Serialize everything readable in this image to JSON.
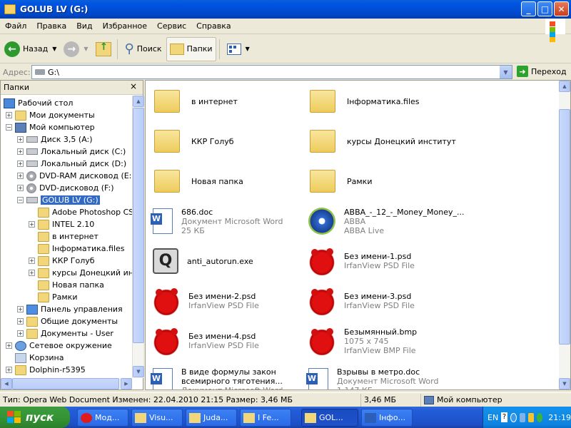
{
  "window": {
    "title": "GOLUB LV (G:)",
    "min": "_",
    "max": "□",
    "close": "✕"
  },
  "menu": [
    "Файл",
    "Правка",
    "Вид",
    "Избранное",
    "Сервис",
    "Справка"
  ],
  "toolbar": {
    "back": "Назад",
    "search": "Поиск",
    "folders": "Папки"
  },
  "address": {
    "label": "Адрес:",
    "value": "G:\\",
    "go": "Переход"
  },
  "folders_pane": {
    "title": "Папки",
    "close": "×",
    "items": [
      {
        "label": "Рабочий стол",
        "icon": "desktop-icon"
      },
      {
        "label": "Мои документы",
        "icon": "folder-icon",
        "expander": "+"
      },
      {
        "label": "Мой компьютер",
        "icon": "computer-icon",
        "expander": "−"
      },
      {
        "label": "Диск 3,5 (A:)",
        "icon": "floppy-icon",
        "expander": "+"
      },
      {
        "label": "Локальный диск (C:)",
        "icon": "drive-icon",
        "expander": "+"
      },
      {
        "label": "Локальный диск (D:)",
        "icon": "drive-icon",
        "expander": "+"
      },
      {
        "label": "DVD-RAM дисковод (E:)",
        "icon": "dvd-icon",
        "expander": "+"
      },
      {
        "label": "DVD-дисковод (F:)",
        "icon": "dvd-icon",
        "expander": "+"
      },
      {
        "label": "GOLUB LV (G:)",
        "icon": "drive-icon",
        "expander": "−",
        "selected": true
      },
      {
        "label": "Adobe Photoshop CS2",
        "icon": "folder-icon"
      },
      {
        "label": "INTEL 2.10",
        "icon": "folder-icon",
        "expander": "+"
      },
      {
        "label": "в интернет",
        "icon": "folder-icon"
      },
      {
        "label": "Інформатика.files",
        "icon": "folder-icon"
      },
      {
        "label": "ККР Голуб",
        "icon": "folder-icon",
        "expander": "+"
      },
      {
        "label": "курсы Донецкий институт",
        "icon": "folder-icon",
        "expander": "+"
      },
      {
        "label": "Новая папка",
        "icon": "folder-icon"
      },
      {
        "label": "Рамки",
        "icon": "folder-icon"
      },
      {
        "label": "Панель управления",
        "icon": "control-panel-icon",
        "expander": "+"
      },
      {
        "label": "Общие документы",
        "icon": "folder-icon",
        "expander": "+"
      },
      {
        "label": "Документы - User",
        "icon": "folder-icon",
        "expander": "+"
      },
      {
        "label": "Сетевое окружение",
        "icon": "network-icon",
        "expander": "+"
      },
      {
        "label": "Корзина",
        "icon": "recycle-bin-icon"
      },
      {
        "label": "Dolphin-r5395",
        "icon": "folder-icon",
        "expander": "+"
      }
    ]
  },
  "files": [
    {
      "name": "в интернет",
      "icon": "folder-icon"
    },
    {
      "name": "Інформатика.files",
      "icon": "folder-icon"
    },
    {
      "name": "ККР Голуб",
      "icon": "folder-icon"
    },
    {
      "name": "курсы Донецкий институт",
      "icon": "folder-icon"
    },
    {
      "name": "Новая папка",
      "icon": "folder-icon"
    },
    {
      "name": "Рамки",
      "icon": "folder-icon"
    },
    {
      "name": "686.doc",
      "line2": "Документ Microsoft Word",
      "line3": "25 КБ",
      "icon": "word-doc-icon"
    },
    {
      "name": "ABBA_-_12_-_Money_Money_...",
      "line2": "ABBA",
      "line3": "ABBA Live",
      "icon": "media-player-icon"
    },
    {
      "name": "anti_autorun.exe",
      "icon": "exe-icon"
    },
    {
      "name": "Без имени-1.psd",
      "line2": "IrfanView PSD File",
      "icon": "irfanview-icon"
    },
    {
      "name": "Без имени-2.psd",
      "line2": "IrfanView PSD File",
      "icon": "irfanview-icon"
    },
    {
      "name": "Без имени-3.psd",
      "line2": "IrfanView PSD File",
      "icon": "irfanview-icon"
    },
    {
      "name": "Без имени-4.psd",
      "line2": "IrfanView PSD File",
      "icon": "irfanview-icon"
    },
    {
      "name": "Безымянный.bmp",
      "line2": "1075 x 745",
      "line3": "IrfanView BMP File",
      "icon": "irfanview-icon"
    },
    {
      "name": "В виде формулы закон",
      "line2": "всемирного тяготения...",
      "line3": "Документ Microsoft Word",
      "icon": "word-doc-icon"
    },
    {
      "name": "Взрывы в метро.doc",
      "line2": "Документ Microsoft Word",
      "line3": "1 147 КБ",
      "icon": "word-doc-icon"
    }
  ],
  "status": {
    "info": "Тип: Opera Web Document Изменен: 22.04.2010 21:15 Размер: 3,46 МБ",
    "size": "3,46 МБ",
    "location": "Мой компьютер"
  },
  "taskbar": {
    "start": "пуск",
    "tasks": [
      {
        "label": "Мод...",
        "icon": "opera-icon"
      },
      {
        "label": "Visu...",
        "icon": "folder-icon"
      },
      {
        "label": "Juda...",
        "icon": "folder-icon"
      },
      {
        "label": "I Fe...",
        "icon": "folder-icon"
      },
      {
        "label": "GOL...",
        "icon": "folder-icon",
        "active": true
      },
      {
        "label": "Інфо...",
        "icon": "word-icon"
      }
    ],
    "lang": "EN",
    "clock": "21:19"
  },
  "colors": {
    "selection": "#316ac5",
    "titlebar": "#0054e3",
    "taskbar": "#245dda",
    "start": "#359435"
  }
}
